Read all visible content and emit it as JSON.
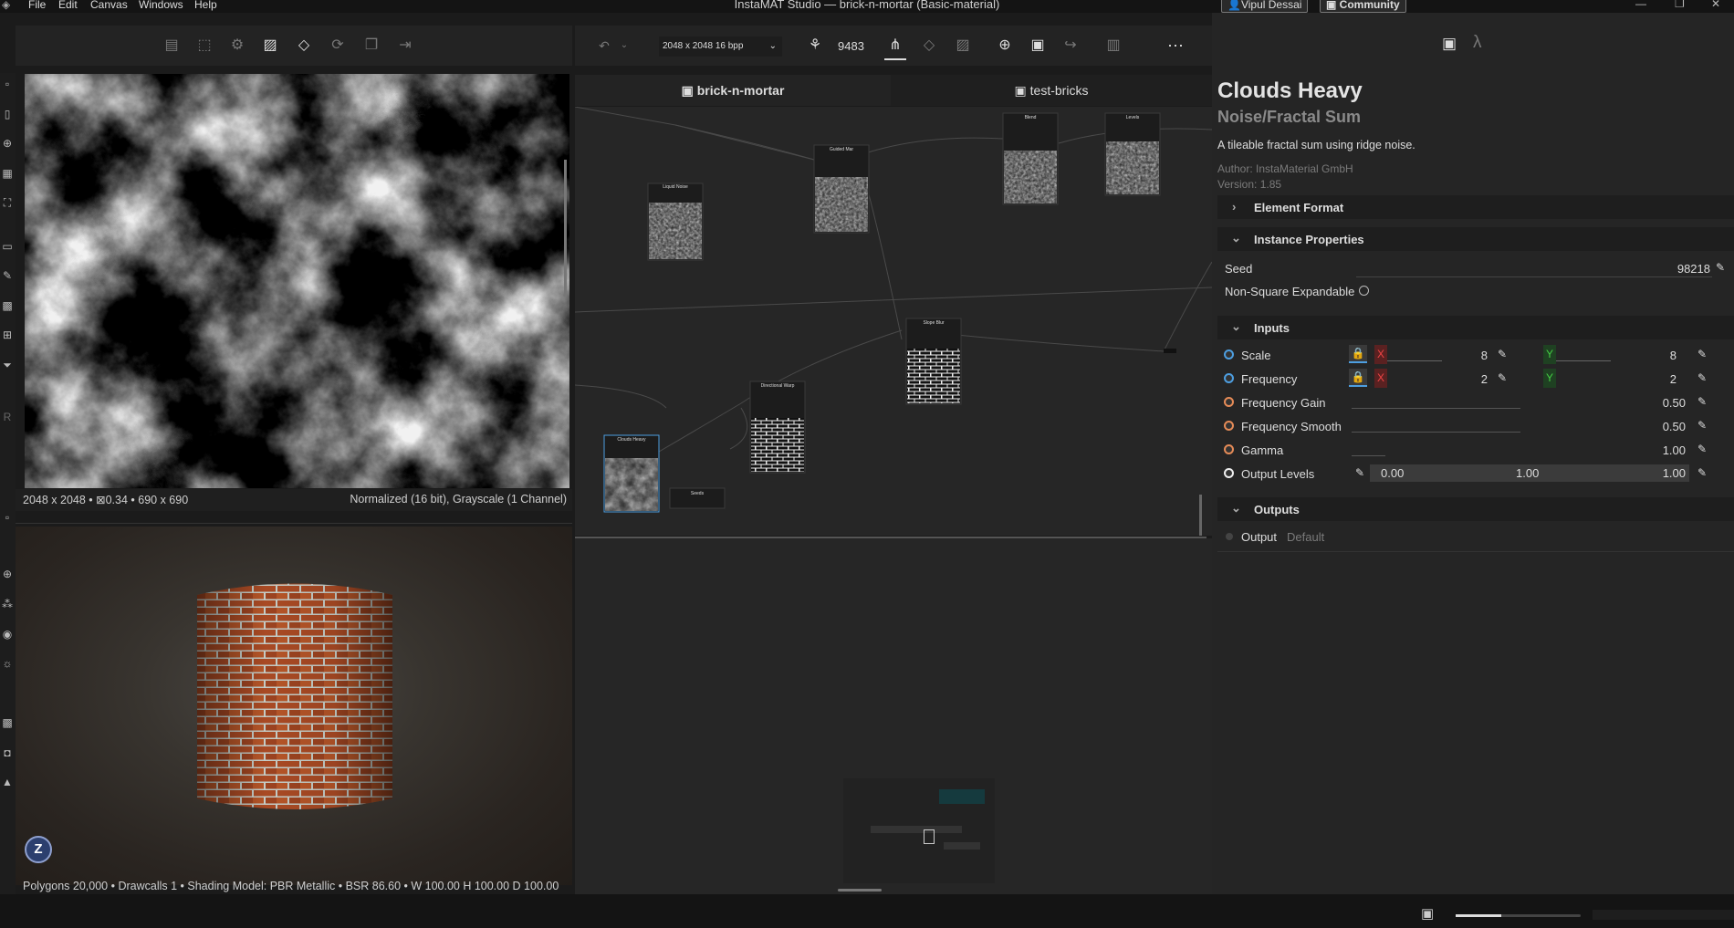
{
  "app": {
    "title": "InstaMAT Studio — brick-n-mortar (Basic-material)",
    "menu": [
      "File",
      "Edit",
      "Canvas",
      "Windows",
      "Help"
    ],
    "user": "Vipul Dessai",
    "community": "Community"
  },
  "left_panel": {
    "info_left": "2048 x 2048 • ⊠0.34 • 690 x 690",
    "info_right": "Normalized (16 bit), Grayscale (1 Channel)",
    "stats": "Polygons 20,000 • Drawcalls 1 • Shading Model: PBR Metallic • BSR 86.60 • W 100.00 H 100.00 D 100.00",
    "avatar": "Z"
  },
  "graph_toolbar": {
    "resolution": "2048 x 2048 16 bpp",
    "seed": "9483"
  },
  "tabs": [
    "brick-n-mortar",
    "test-bricks"
  ],
  "nodes": [
    {
      "label": "Liquid Noise",
      "kind": "noise"
    },
    {
      "label": "Guided Mar",
      "kind": "noise"
    },
    {
      "label": "Blend",
      "kind": "noise"
    },
    {
      "label": "Levels",
      "kind": "noise"
    },
    {
      "label": "Slope Blur",
      "kind": "brick"
    },
    {
      "label": "Directional Warp",
      "kind": "brick"
    },
    {
      "label": "Clouds Heavy",
      "kind": "cloud"
    },
    {
      "label": "Seeds",
      "kind": "small"
    }
  ],
  "properties": {
    "title": "Clouds Heavy",
    "subtitle": "Noise/Fractal Sum",
    "description": "A tileable fractal sum using ridge noise.",
    "author": "Author: InstaMaterial GmbH",
    "version": "Version: 1.85",
    "sections": {
      "element_format": "Element Format",
      "instance_properties": "Instance Properties",
      "inputs": "Inputs",
      "outputs": "Outputs"
    },
    "seed_label": "Seed",
    "seed_value": "98218",
    "nonsquare_label": "Non-Square Expandable",
    "scale": {
      "label": "Scale",
      "x": "8",
      "y": "8"
    },
    "frequency": {
      "label": "Frequency",
      "x": "2",
      "y": "2"
    },
    "frequency_gain": {
      "label": "Frequency Gain",
      "value": "0.50",
      "fill": 0.5
    },
    "frequency_smooth": {
      "label": "Frequency Smooth",
      "value": "0.50",
      "fill": 0.5
    },
    "gamma": {
      "label": "Gamma",
      "value": "1.00",
      "fill": 0.1
    },
    "output_levels": {
      "label": "Output Levels",
      "low": "0.00",
      "mid": "1.00",
      "high": "1.00"
    },
    "output": {
      "label": "Output",
      "value": "Default"
    },
    "axis_x": "X",
    "axis_y": "Y"
  }
}
